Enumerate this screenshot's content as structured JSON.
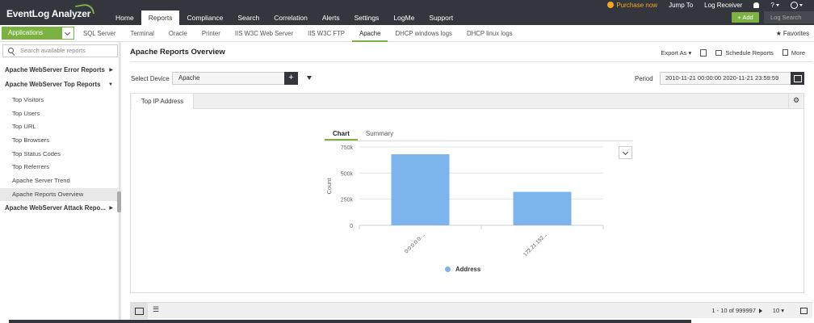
{
  "app": {
    "title": "EventLog Analyzer"
  },
  "nav": {
    "items": [
      {
        "label": "Home",
        "active": false
      },
      {
        "label": "Reports",
        "active": true
      },
      {
        "label": "Compliance",
        "active": false
      },
      {
        "label": "Search",
        "active": false
      },
      {
        "label": "Correlation",
        "active": false
      },
      {
        "label": "Alerts",
        "active": false
      },
      {
        "label": "Settings",
        "active": false
      },
      {
        "label": "LogMe",
        "active": false
      },
      {
        "label": "Support",
        "active": false
      }
    ]
  },
  "topright": {
    "purchase": "Purchase now",
    "jump_to": "Jump To",
    "log_receiver": "Log Receiver",
    "help": "?",
    "add_label": "+ Add",
    "log_search": "Log Search"
  },
  "subnav": {
    "app_dropdown": "Applications",
    "tabs": [
      {
        "label": "SQL Server",
        "active": false
      },
      {
        "label": "Terminal",
        "active": false
      },
      {
        "label": "Oracle",
        "active": false
      },
      {
        "label": "Printer",
        "active": false
      },
      {
        "label": "IIS W3C Web Server",
        "active": false
      },
      {
        "label": "IIS W3C FTP",
        "active": false
      },
      {
        "label": "Apache",
        "active": true
      },
      {
        "label": "DHCP windows logs",
        "active": false
      },
      {
        "label": "DHCP linux logs",
        "active": false
      }
    ],
    "favorites": "★ Favorites"
  },
  "sidebar": {
    "search_placeholder": "Search available reports",
    "groups": [
      {
        "label": "Apache WebServer Error Reports",
        "arrow": "▶"
      },
      {
        "label": "Apache WebServer Top Reports",
        "arrow": "▼"
      },
      {
        "label": "Apache WebServer Attack Repo...",
        "arrow": "▶"
      }
    ],
    "items": [
      {
        "label": "Top Visitors",
        "active": false
      },
      {
        "label": "Top Users",
        "active": false
      },
      {
        "label": "Top URL",
        "active": false
      },
      {
        "label": "Top Browsers",
        "active": false
      },
      {
        "label": "Top Status Codes",
        "active": false
      },
      {
        "label": "Top Referrers",
        "active": false
      },
      {
        "label": "Apache Server Trend",
        "active": false
      },
      {
        "label": "Apache Reports Overview",
        "active": true
      }
    ]
  },
  "main": {
    "title": "Apache Reports Overview",
    "export": "Export As ▾",
    "schedule": "Schedule Reports",
    "more": "More",
    "select_device_label": "Select Device",
    "device_value": "Apache",
    "device_add": "+",
    "period_label": "Period",
    "period_value": "2010-11-21 00:00:00   2020-11-21 23:59:59",
    "card_tab": "Top IP Address",
    "chart_tabs": [
      {
        "label": "Chart",
        "active": true
      },
      {
        "label": "Summary",
        "active": false
      }
    ],
    "pager_text": "1 - 10 of 999997",
    "per_page": "10 ▾"
  },
  "chart_data": {
    "type": "bar",
    "categories": [
      "0:0:0:0:0:...",
      "172.21.152..."
    ],
    "series": [
      {
        "name": "Address",
        "values": [
          680000,
          320000
        ]
      }
    ],
    "xlabel": "",
    "ylabel": "Count",
    "ylim": [
      0,
      750000
    ],
    "yticks": [
      "0",
      "250k",
      "500k",
      "750k"
    ],
    "grid": true,
    "legend_position": "bottom",
    "bar_color": "#7cb5ec"
  }
}
